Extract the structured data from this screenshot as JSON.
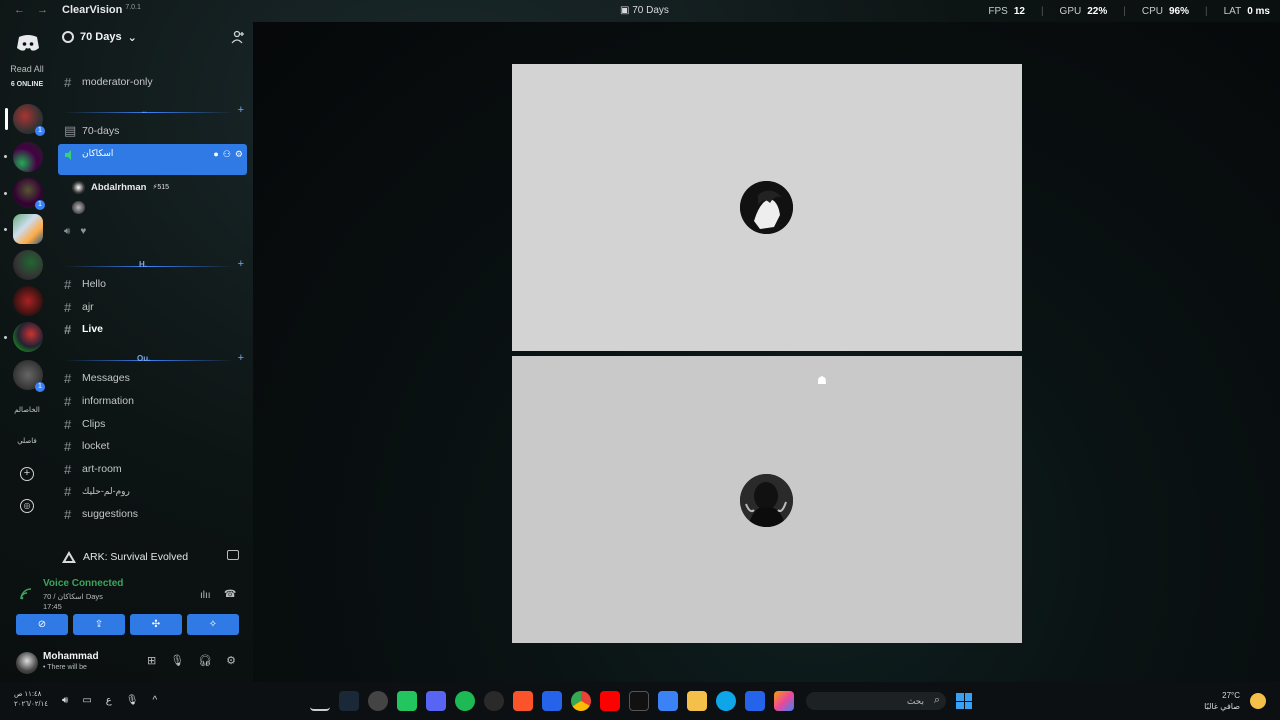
{
  "titlebar": {
    "brand": "ClearVision",
    "version": "7.0.1",
    "window_title": "70 Days",
    "stats": [
      {
        "label": "FPS",
        "value": "12"
      },
      {
        "label": "GPU",
        "value": "22%"
      },
      {
        "label": "CPU",
        "value": "96%"
      },
      {
        "label": "LAT",
        "value": "0 ms"
      }
    ]
  },
  "rail": {
    "read_all": "Read All",
    "online": "6 ONLINE",
    "server_text_1": "الخاصالم",
    "server_text_2": "فاصلي",
    "badges": [
      "1",
      "1",
      "1",
      "1"
    ]
  },
  "guild": {
    "name": "70 Days"
  },
  "channels": {
    "moderator": "moderator-only",
    "cat1_label": "..",
    "forum": "70-days",
    "active_voice": "اسكاكان",
    "voice_users": [
      {
        "name": "Abdalrhman",
        "boost": "515"
      },
      {
        "name": ""
      }
    ],
    "cat2_label": "H.",
    "cat2": [
      "Hello",
      "ajr",
      "Live"
    ],
    "cat3_label": "Ou.",
    "cat3": [
      "Messages",
      "information",
      "Clips",
      "locket",
      "art-room",
      "روم-لم-حليك",
      "suggestions"
    ]
  },
  "activity": {
    "game": "ARK: Survival Evolved"
  },
  "voice": {
    "status": "Voice Connected",
    "channel": "70 / اسكاكان Days",
    "time": "17:45"
  },
  "user": {
    "name": "Mohammad",
    "status": "• There will be"
  },
  "taskbar": {
    "time": "١١:٤٨ ص",
    "date": "٢٠٢٦/٠٢/١٤",
    "lang": "ع",
    "search_placeholder": "بحث",
    "weather_temp": "27°C",
    "weather_desc": "صافي غالبًا"
  },
  "colors": {
    "accent": "#2f7ae5",
    "voice_green": "#3ba55d",
    "tile_bg": "#d3d3d3"
  }
}
